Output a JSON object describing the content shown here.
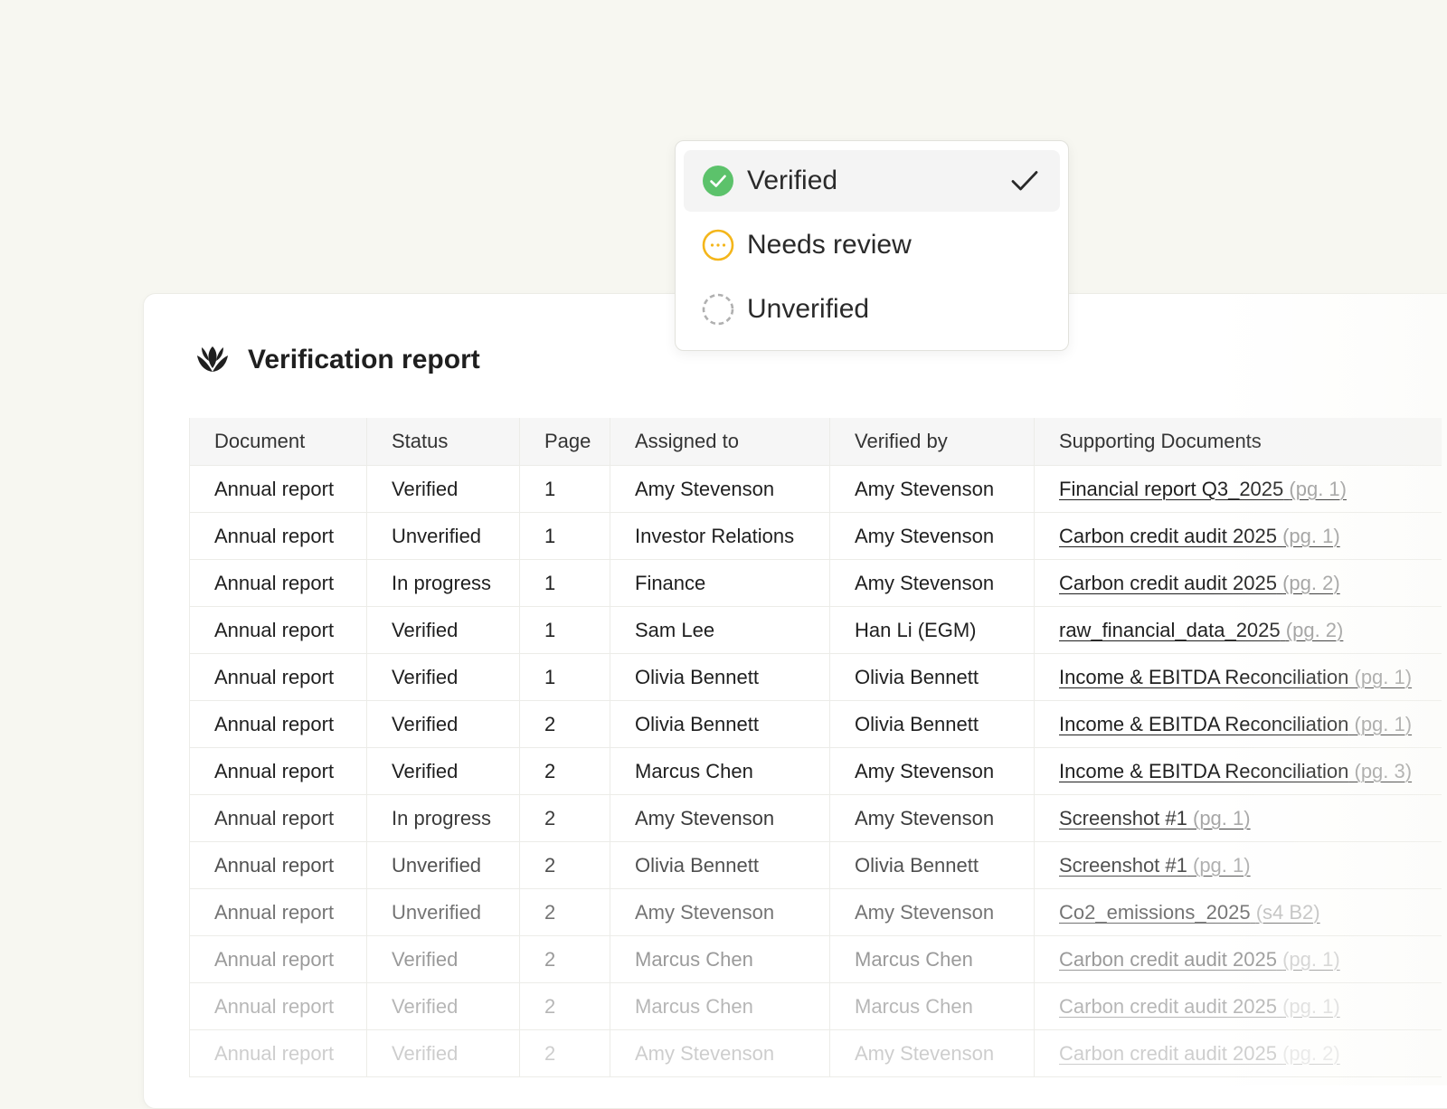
{
  "status_menu": {
    "options": [
      {
        "label": "Verified",
        "icon": "check-circle-icon",
        "color": "#5cc26b",
        "selected": true
      },
      {
        "label": "Needs review",
        "icon": "ellipsis-circle-icon",
        "color": "#f4b61b",
        "selected": false
      },
      {
        "label": "Unverified",
        "icon": "dashed-circle-icon",
        "color": "#b0b0b0",
        "selected": false
      }
    ]
  },
  "report": {
    "title": "Verification report",
    "logo_icon": "lotus-logo-icon",
    "columns": [
      "Document",
      "Status",
      "Page",
      "Assigned to",
      "Verified by",
      "Supporting Documents"
    ],
    "rows": [
      {
        "document": "Annual report",
        "status": "Verified",
        "page": "1",
        "assigned_to": "Amy Stevenson",
        "verified_by": "Amy Stevenson",
        "support_doc": "Financial report Q3_2025",
        "support_ref": "(pg. 1)"
      },
      {
        "document": "Annual report",
        "status": "Unverified",
        "page": "1",
        "assigned_to": "Investor Relations",
        "verified_by": "Amy Stevenson",
        "support_doc": "Carbon credit audit 2025",
        "support_ref": "(pg. 1)"
      },
      {
        "document": "Annual report",
        "status": "In progress",
        "page": "1",
        "assigned_to": "Finance",
        "verified_by": "Amy Stevenson",
        "support_doc": "Carbon credit audit 2025",
        "support_ref": "(pg. 2)"
      },
      {
        "document": "Annual report",
        "status": "Verified",
        "page": "1",
        "assigned_to": "Sam Lee",
        "verified_by": "Han Li (EGM)",
        "support_doc": "raw_financial_data_2025",
        "support_ref": "(pg. 2)"
      },
      {
        "document": "Annual report",
        "status": "Verified",
        "page": "1",
        "assigned_to": "Olivia Bennett",
        "verified_by": "Olivia Bennett",
        "support_doc": "Income & EBITDA Reconciliation",
        "support_ref": "(pg. 1)"
      },
      {
        "document": "Annual report",
        "status": "Verified",
        "page": "2",
        "assigned_to": "Olivia Bennett",
        "verified_by": "Olivia Bennett",
        "support_doc": "Income & EBITDA Reconciliation",
        "support_ref": "(pg. 1)"
      },
      {
        "document": "Annual report",
        "status": "Verified",
        "page": "2",
        "assigned_to": "Marcus Chen",
        "verified_by": "Amy Stevenson",
        "support_doc": "Income & EBITDA Reconciliation",
        "support_ref": "(pg. 3)"
      },
      {
        "document": "Annual report",
        "status": "In progress",
        "page": "2",
        "assigned_to": "Amy Stevenson",
        "verified_by": "Amy Stevenson",
        "support_doc": "Screenshot #1",
        "support_ref": "(pg. 1)"
      },
      {
        "document": "Annual report",
        "status": "Unverified",
        "page": "2",
        "assigned_to": "Olivia Bennett",
        "verified_by": "Olivia Bennett",
        "support_doc": "Screenshot #1",
        "support_ref": "(pg. 1)"
      },
      {
        "document": "Annual report",
        "status": "Unverified",
        "page": "2",
        "assigned_to": "Amy Stevenson",
        "verified_by": "Amy Stevenson",
        "support_doc": "Co2_emissions_2025",
        "support_ref": "(s4 B2)"
      },
      {
        "document": "Annual report",
        "status": "Verified",
        "page": "2",
        "assigned_to": "Marcus Chen",
        "verified_by": "Marcus Chen",
        "support_doc": "Carbon credit audit 2025",
        "support_ref": "(pg. 1)"
      },
      {
        "document": "Annual report",
        "status": "Verified",
        "page": "2",
        "assigned_to": "Marcus Chen",
        "verified_by": "Marcus Chen",
        "support_doc": "Carbon credit audit 2025",
        "support_ref": "(pg. 1)"
      },
      {
        "document": "Annual report",
        "status": "Verified",
        "page": "2",
        "assigned_to": "Amy Stevenson",
        "verified_by": "Amy Stevenson",
        "support_doc": "Carbon credit audit 2025",
        "support_ref": "(pg. 2)"
      }
    ]
  }
}
